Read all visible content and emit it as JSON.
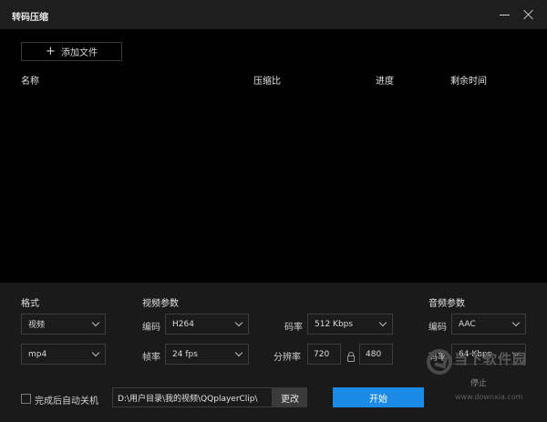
{
  "window": {
    "title": "转码压缩"
  },
  "file_area": {
    "add_button_label": "添加文件",
    "columns": [
      "名称",
      "压缩比",
      "进度",
      "剩余时间"
    ]
  },
  "format": {
    "section_label": "格式",
    "type_value": "视频",
    "container_value": "mp4"
  },
  "video": {
    "section_label": "视频参数",
    "codec_label": "编码",
    "codec_value": "H264",
    "fps_label": "帧率",
    "fps_value": "24 fps",
    "bitrate_label": "码率",
    "bitrate_value": "512 Kbps",
    "resolution_label": "分辨率",
    "width_value": "720",
    "height_value": "480"
  },
  "audio": {
    "section_label": "音频参数",
    "codec_label": "编码",
    "codec_value": "AAC",
    "bitrate_label": "码率",
    "bitrate_value": "64 Kbps"
  },
  "footer": {
    "auto_shutdown_label": "完成后自动关机",
    "auto_shutdown_checked": false,
    "output_path": "D:\\用户目录\\我的视频\\QQplayerClip\\",
    "change_label": "更改",
    "start_label": "开始",
    "stop_label": "停止"
  },
  "watermark": {
    "brand": "当下软件园",
    "url": "www.downxia.com"
  },
  "colors": {
    "accent": "#1a8ae6",
    "background": "#1a1a1a",
    "list_background": "#000000"
  }
}
